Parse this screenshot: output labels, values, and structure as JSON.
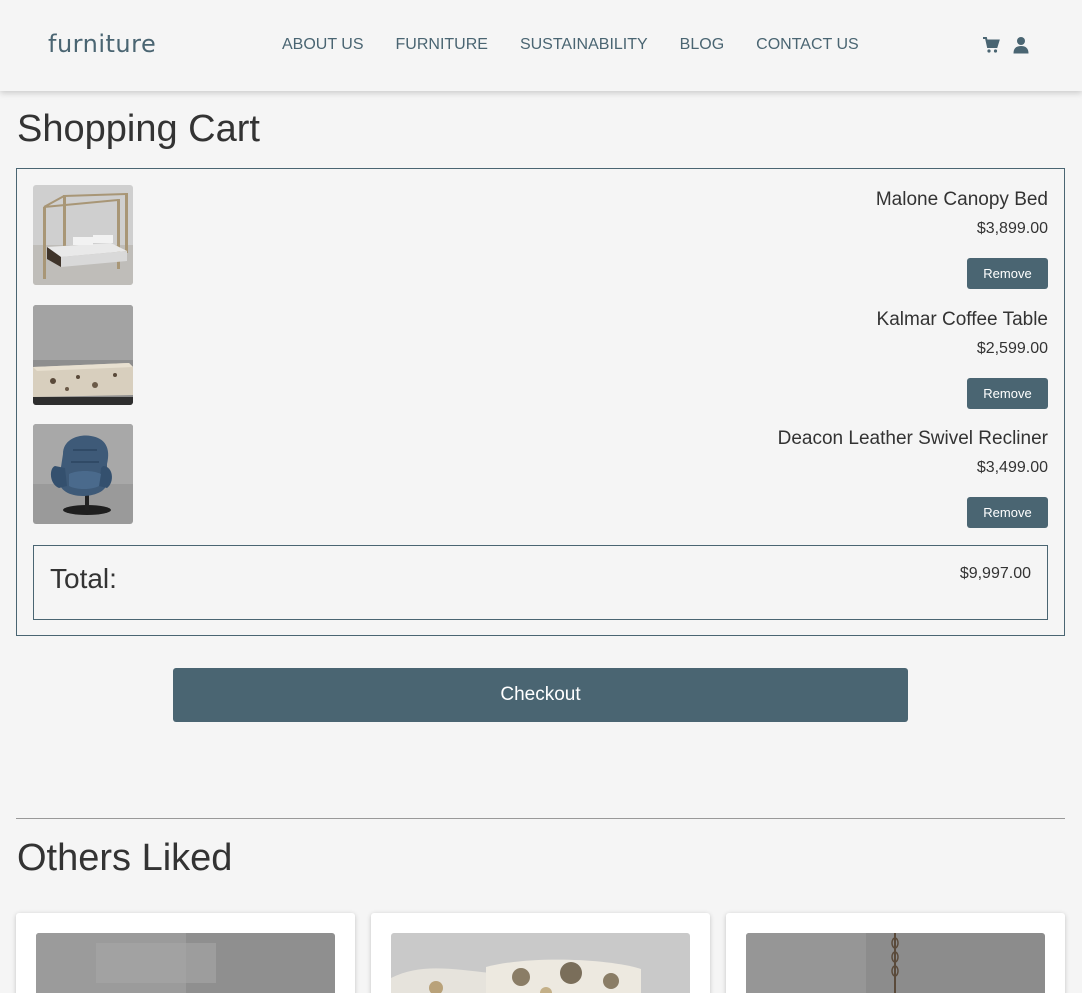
{
  "header": {
    "brand": "furniture",
    "nav": [
      "ABOUT US",
      "FURNITURE",
      "SUSTAINABILITY",
      "BLOG",
      "CONTACT US"
    ],
    "icons": [
      "cart-icon",
      "user-icon"
    ]
  },
  "cart": {
    "title": "Shopping Cart",
    "items": [
      {
        "name": "Malone Canopy Bed",
        "price": "$3,899.00",
        "remove_label": "Remove"
      },
      {
        "name": "Kalmar Coffee Table",
        "price": "$2,599.00",
        "remove_label": "Remove"
      },
      {
        "name": "Deacon Leather Swivel Recliner",
        "price": "$3,499.00",
        "remove_label": "Remove"
      }
    ],
    "total_label": "Total:",
    "total_value": "$9,997.00",
    "checkout_label": "Checkout"
  },
  "others": {
    "title": "Others Liked"
  },
  "colors": {
    "accent": "#4a6572",
    "background": "#f5f5f5",
    "text": "#333333"
  }
}
